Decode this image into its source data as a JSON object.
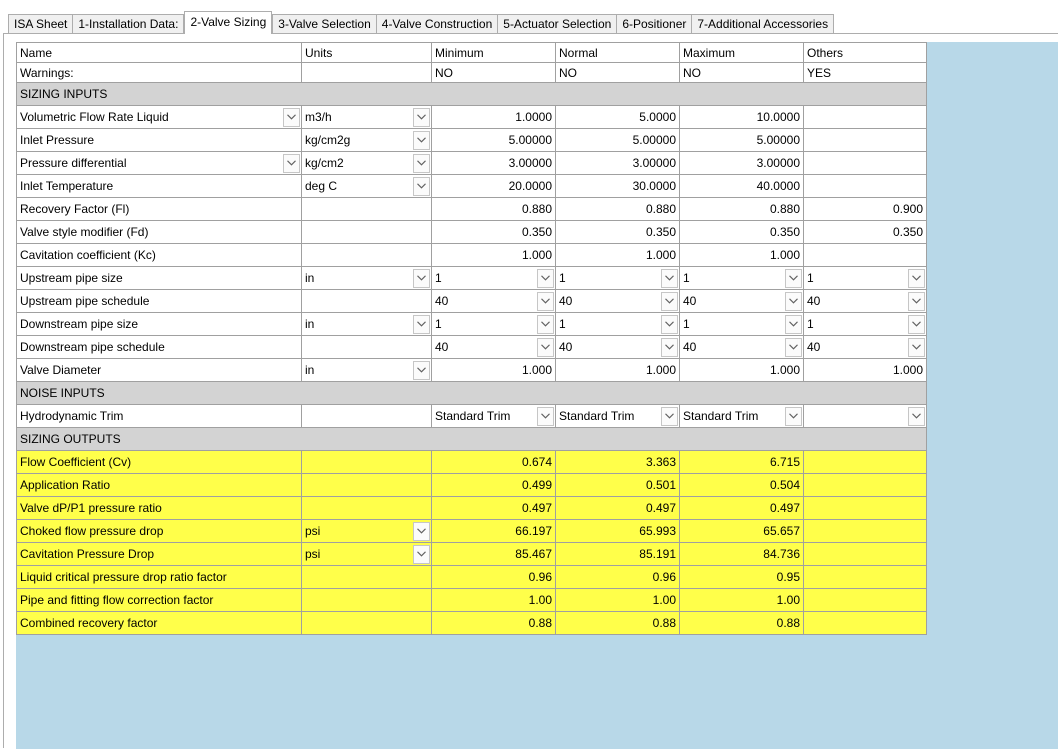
{
  "tabs": [
    {
      "label": "ISA Sheet"
    },
    {
      "label": "1-Installation Data:"
    },
    {
      "label": "2-Valve Sizing"
    },
    {
      "label": "3-Valve Selection"
    },
    {
      "label": "4-Valve Construction"
    },
    {
      "label": "5-Actuator Selection"
    },
    {
      "label": "6-Positioner"
    },
    {
      "label": "7-Additional Accessories"
    }
  ],
  "active_tab": "2-Valve Sizing",
  "colors": {
    "section": "#d3d3d3",
    "output_highlight": "#ffff4a",
    "empty_area": "#b8d8e8"
  },
  "grid": {
    "header": {
      "name": "Name",
      "units": "Units",
      "min": "Minimum",
      "normal": "Normal",
      "max": "Maximum",
      "others": "Others"
    },
    "warnings": {
      "name": "Warnings:",
      "min": "NO",
      "normal": "NO",
      "max": "NO",
      "others": "YES"
    },
    "sections": {
      "sizing_inputs": "SIZING INPUTS",
      "noise_inputs": "NOISE INPUTS",
      "sizing_outputs": "SIZING OUTPUTS"
    },
    "sizing_inputs": [
      {
        "name": "Volumetric Flow Rate Liquid",
        "units": "m3/h",
        "min": "1.0000",
        "normal": "5.0000",
        "max": "10.0000",
        "others": ""
      },
      {
        "name": "Inlet Pressure",
        "units": "kg/cm2g",
        "min": "5.00000",
        "normal": "5.00000",
        "max": "5.00000",
        "others": ""
      },
      {
        "name": "Pressure differential",
        "units": "kg/cm2",
        "min": "3.00000",
        "normal": "3.00000",
        "max": "3.00000",
        "others": ""
      },
      {
        "name": "Inlet Temperature",
        "units": "deg C",
        "min": "20.0000",
        "normal": "30.0000",
        "max": "40.0000",
        "others": ""
      },
      {
        "name": "Recovery Factor (Fl)",
        "units": "",
        "min": "0.880",
        "normal": "0.880",
        "max": "0.880",
        "others": "0.900"
      },
      {
        "name": "Valve style modifier (Fd)",
        "units": "",
        "min": "0.350",
        "normal": "0.350",
        "max": "0.350",
        "others": "0.350"
      },
      {
        "name": "Cavitation coefficient (Kc)",
        "units": "",
        "min": "1.000",
        "normal": "1.000",
        "max": "1.000",
        "others": ""
      },
      {
        "name": "Upstream pipe size",
        "units": "in",
        "min": "1",
        "normal": "1",
        "max": "1",
        "others": "1"
      },
      {
        "name": "Upstream pipe schedule",
        "units": "",
        "min": "40",
        "normal": "40",
        "max": "40",
        "others": "40"
      },
      {
        "name": "Downstream pipe size",
        "units": "in",
        "min": "1",
        "normal": "1",
        "max": "1",
        "others": "1"
      },
      {
        "name": "Downstream pipe schedule",
        "units": "",
        "min": "40",
        "normal": "40",
        "max": "40",
        "others": "40"
      },
      {
        "name": "Valve Diameter",
        "units": "in",
        "min": "1.000",
        "normal": "1.000",
        "max": "1.000",
        "others": "1.000"
      }
    ],
    "noise_inputs": [
      {
        "name": "Hydrodynamic Trim",
        "units": "",
        "min": "Standard Trim",
        "normal": "Standard Trim",
        "max": "Standard Trim",
        "others": ""
      }
    ],
    "sizing_outputs": [
      {
        "name": "Flow Coefficient (Cv)",
        "units": "",
        "min": "0.674",
        "normal": "3.363",
        "max": "6.715",
        "others": ""
      },
      {
        "name": "Application Ratio",
        "units": "",
        "min": "0.499",
        "normal": "0.501",
        "max": "0.504",
        "others": ""
      },
      {
        "name": "Valve dP/P1 pressure ratio",
        "units": "",
        "min": "0.497",
        "normal": "0.497",
        "max": "0.497",
        "others": ""
      },
      {
        "name": "Choked flow pressure drop",
        "units": "psi",
        "min": "66.197",
        "normal": "65.993",
        "max": "65.657",
        "others": ""
      },
      {
        "name": "Cavitation Pressure Drop",
        "units": "psi",
        "min": "85.467",
        "normal": "85.191",
        "max": "84.736",
        "others": ""
      },
      {
        "name": "Liquid critical pressure drop ratio factor",
        "units": "",
        "min": "0.96",
        "normal": "0.96",
        "max": "0.95",
        "others": ""
      },
      {
        "name": "Pipe and fitting flow correction factor",
        "units": "",
        "min": "1.00",
        "normal": "1.00",
        "max": "1.00",
        "others": ""
      },
      {
        "name": "Combined recovery factor",
        "units": "",
        "min": "0.88",
        "normal": "0.88",
        "max": "0.88",
        "others": ""
      }
    ]
  }
}
